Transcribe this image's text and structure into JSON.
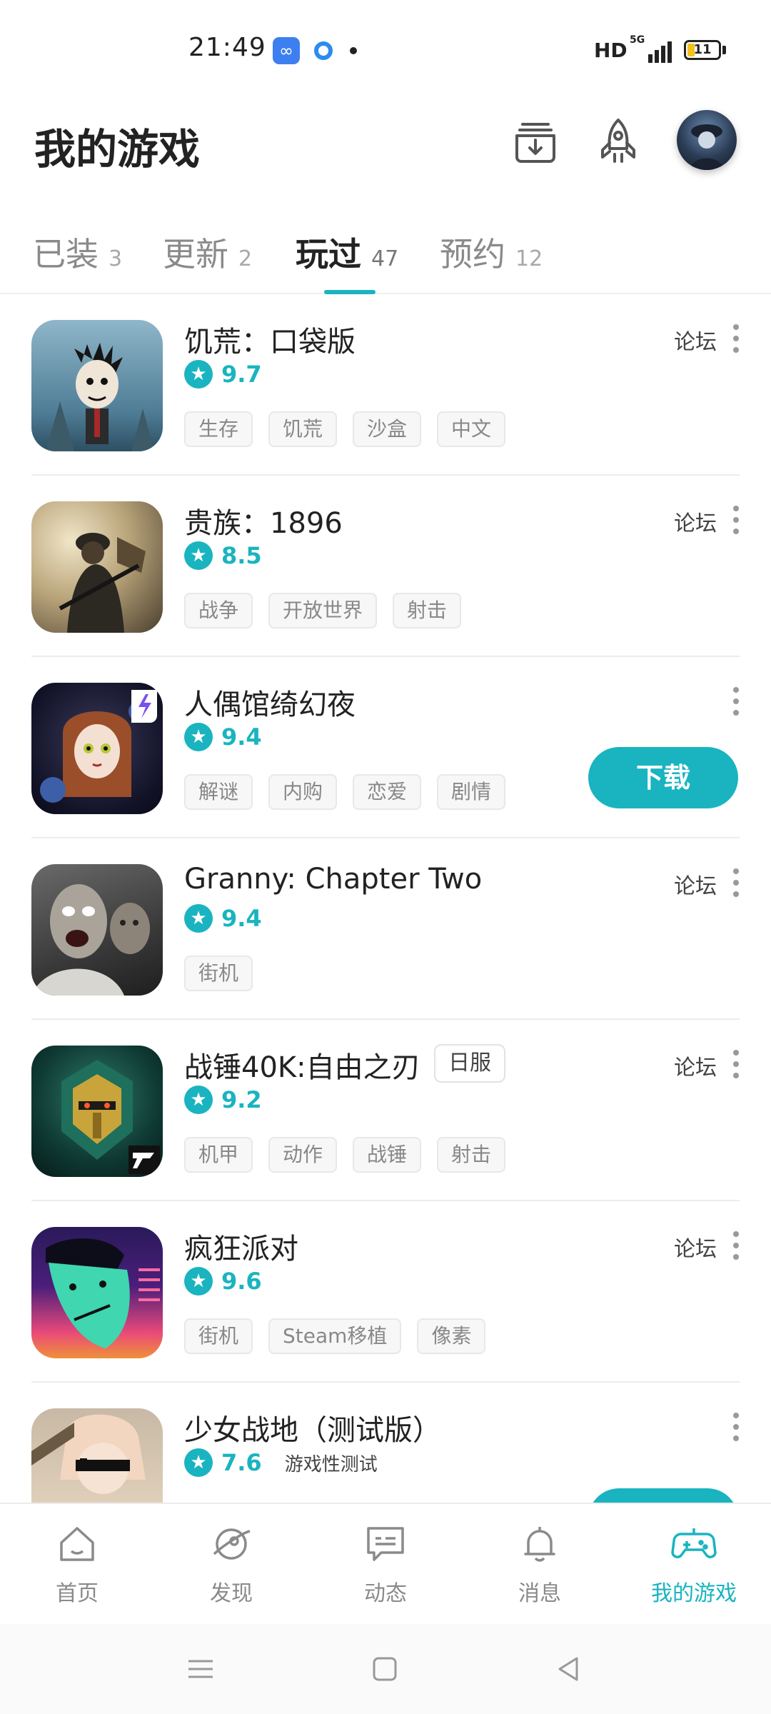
{
  "status_bar": {
    "time": "21:49",
    "network": "HD",
    "signal": "5G",
    "battery": "11"
  },
  "header": {
    "title": "我的游戏"
  },
  "tabs": [
    {
      "label": "已装",
      "count": "3"
    },
    {
      "label": "更新",
      "count": "2"
    },
    {
      "label": "玩过",
      "count": "47",
      "active": true
    },
    {
      "label": "预约",
      "count": "12"
    }
  ],
  "games": [
    {
      "name": "饥荒：口袋版",
      "rating": "9.7",
      "tags": [
        "生存",
        "饥荒",
        "沙盒",
        "中文"
      ],
      "forum": "论坛"
    },
    {
      "name": "贵族：1896",
      "rating": "8.5",
      "tags": [
        "战争",
        "开放世界",
        "射击"
      ],
      "forum": "论坛"
    },
    {
      "name": "人偶馆绮幻夜",
      "rating": "9.4",
      "tags": [
        "解谜",
        "内购",
        "恋爱",
        "剧情"
      ],
      "action": "下载"
    },
    {
      "name": "Granny: Chapter Two",
      "rating": "9.4",
      "tags": [
        "街机"
      ],
      "forum": "论坛"
    },
    {
      "name": "战锤40K:自由之刃",
      "badge": "日服",
      "rating": "9.2",
      "tags": [
        "机甲",
        "动作",
        "战锤",
        "射击"
      ],
      "forum": "论坛"
    },
    {
      "name": "疯狂派对",
      "rating": "9.6",
      "tags": [
        "街机",
        "Steam移植",
        "像素"
      ],
      "forum": "论坛"
    },
    {
      "name": "少女战地（测试版）",
      "rating": "7.6",
      "note": "游戏性测试"
    }
  ],
  "bottom_nav": [
    {
      "label": "首页",
      "icon": "home-icon"
    },
    {
      "label": "发现",
      "icon": "compass-icon"
    },
    {
      "label": "动态",
      "icon": "chat-icon"
    },
    {
      "label": "消息",
      "icon": "bell-icon"
    },
    {
      "label": "我的游戏",
      "icon": "gamepad-icon",
      "active": true
    }
  ],
  "colors": {
    "accent": "#19b4c0",
    "text": "#222222",
    "muted": "#8a8a8a"
  }
}
